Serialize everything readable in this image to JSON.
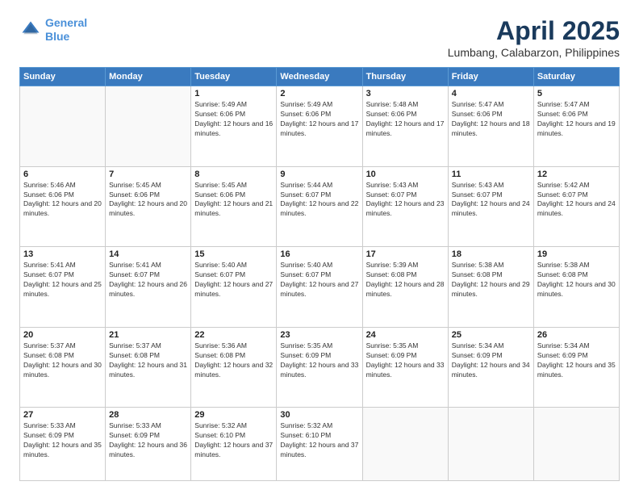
{
  "header": {
    "logo_line1": "General",
    "logo_line2": "Blue",
    "month_title": "April 2025",
    "location": "Lumbang, Calabarzon, Philippines"
  },
  "days_of_week": [
    "Sunday",
    "Monday",
    "Tuesday",
    "Wednesday",
    "Thursday",
    "Friday",
    "Saturday"
  ],
  "weeks": [
    [
      {
        "day": "",
        "info": ""
      },
      {
        "day": "",
        "info": ""
      },
      {
        "day": "1",
        "info": "Sunrise: 5:49 AM\nSunset: 6:06 PM\nDaylight: 12 hours and 16 minutes."
      },
      {
        "day": "2",
        "info": "Sunrise: 5:49 AM\nSunset: 6:06 PM\nDaylight: 12 hours and 17 minutes."
      },
      {
        "day": "3",
        "info": "Sunrise: 5:48 AM\nSunset: 6:06 PM\nDaylight: 12 hours and 17 minutes."
      },
      {
        "day": "4",
        "info": "Sunrise: 5:47 AM\nSunset: 6:06 PM\nDaylight: 12 hours and 18 minutes."
      },
      {
        "day": "5",
        "info": "Sunrise: 5:47 AM\nSunset: 6:06 PM\nDaylight: 12 hours and 19 minutes."
      }
    ],
    [
      {
        "day": "6",
        "info": "Sunrise: 5:46 AM\nSunset: 6:06 PM\nDaylight: 12 hours and 20 minutes."
      },
      {
        "day": "7",
        "info": "Sunrise: 5:45 AM\nSunset: 6:06 PM\nDaylight: 12 hours and 20 minutes."
      },
      {
        "day": "8",
        "info": "Sunrise: 5:45 AM\nSunset: 6:06 PM\nDaylight: 12 hours and 21 minutes."
      },
      {
        "day": "9",
        "info": "Sunrise: 5:44 AM\nSunset: 6:07 PM\nDaylight: 12 hours and 22 minutes."
      },
      {
        "day": "10",
        "info": "Sunrise: 5:43 AM\nSunset: 6:07 PM\nDaylight: 12 hours and 23 minutes."
      },
      {
        "day": "11",
        "info": "Sunrise: 5:43 AM\nSunset: 6:07 PM\nDaylight: 12 hours and 24 minutes."
      },
      {
        "day": "12",
        "info": "Sunrise: 5:42 AM\nSunset: 6:07 PM\nDaylight: 12 hours and 24 minutes."
      }
    ],
    [
      {
        "day": "13",
        "info": "Sunrise: 5:41 AM\nSunset: 6:07 PM\nDaylight: 12 hours and 25 minutes."
      },
      {
        "day": "14",
        "info": "Sunrise: 5:41 AM\nSunset: 6:07 PM\nDaylight: 12 hours and 26 minutes."
      },
      {
        "day": "15",
        "info": "Sunrise: 5:40 AM\nSunset: 6:07 PM\nDaylight: 12 hours and 27 minutes."
      },
      {
        "day": "16",
        "info": "Sunrise: 5:40 AM\nSunset: 6:07 PM\nDaylight: 12 hours and 27 minutes."
      },
      {
        "day": "17",
        "info": "Sunrise: 5:39 AM\nSunset: 6:08 PM\nDaylight: 12 hours and 28 minutes."
      },
      {
        "day": "18",
        "info": "Sunrise: 5:38 AM\nSunset: 6:08 PM\nDaylight: 12 hours and 29 minutes."
      },
      {
        "day": "19",
        "info": "Sunrise: 5:38 AM\nSunset: 6:08 PM\nDaylight: 12 hours and 30 minutes."
      }
    ],
    [
      {
        "day": "20",
        "info": "Sunrise: 5:37 AM\nSunset: 6:08 PM\nDaylight: 12 hours and 30 minutes."
      },
      {
        "day": "21",
        "info": "Sunrise: 5:37 AM\nSunset: 6:08 PM\nDaylight: 12 hours and 31 minutes."
      },
      {
        "day": "22",
        "info": "Sunrise: 5:36 AM\nSunset: 6:08 PM\nDaylight: 12 hours and 32 minutes."
      },
      {
        "day": "23",
        "info": "Sunrise: 5:35 AM\nSunset: 6:09 PM\nDaylight: 12 hours and 33 minutes."
      },
      {
        "day": "24",
        "info": "Sunrise: 5:35 AM\nSunset: 6:09 PM\nDaylight: 12 hours and 33 minutes."
      },
      {
        "day": "25",
        "info": "Sunrise: 5:34 AM\nSunset: 6:09 PM\nDaylight: 12 hours and 34 minutes."
      },
      {
        "day": "26",
        "info": "Sunrise: 5:34 AM\nSunset: 6:09 PM\nDaylight: 12 hours and 35 minutes."
      }
    ],
    [
      {
        "day": "27",
        "info": "Sunrise: 5:33 AM\nSunset: 6:09 PM\nDaylight: 12 hours and 35 minutes."
      },
      {
        "day": "28",
        "info": "Sunrise: 5:33 AM\nSunset: 6:09 PM\nDaylight: 12 hours and 36 minutes."
      },
      {
        "day": "29",
        "info": "Sunrise: 5:32 AM\nSunset: 6:10 PM\nDaylight: 12 hours and 37 minutes."
      },
      {
        "day": "30",
        "info": "Sunrise: 5:32 AM\nSunset: 6:10 PM\nDaylight: 12 hours and 37 minutes."
      },
      {
        "day": "",
        "info": ""
      },
      {
        "day": "",
        "info": ""
      },
      {
        "day": "",
        "info": ""
      }
    ]
  ]
}
